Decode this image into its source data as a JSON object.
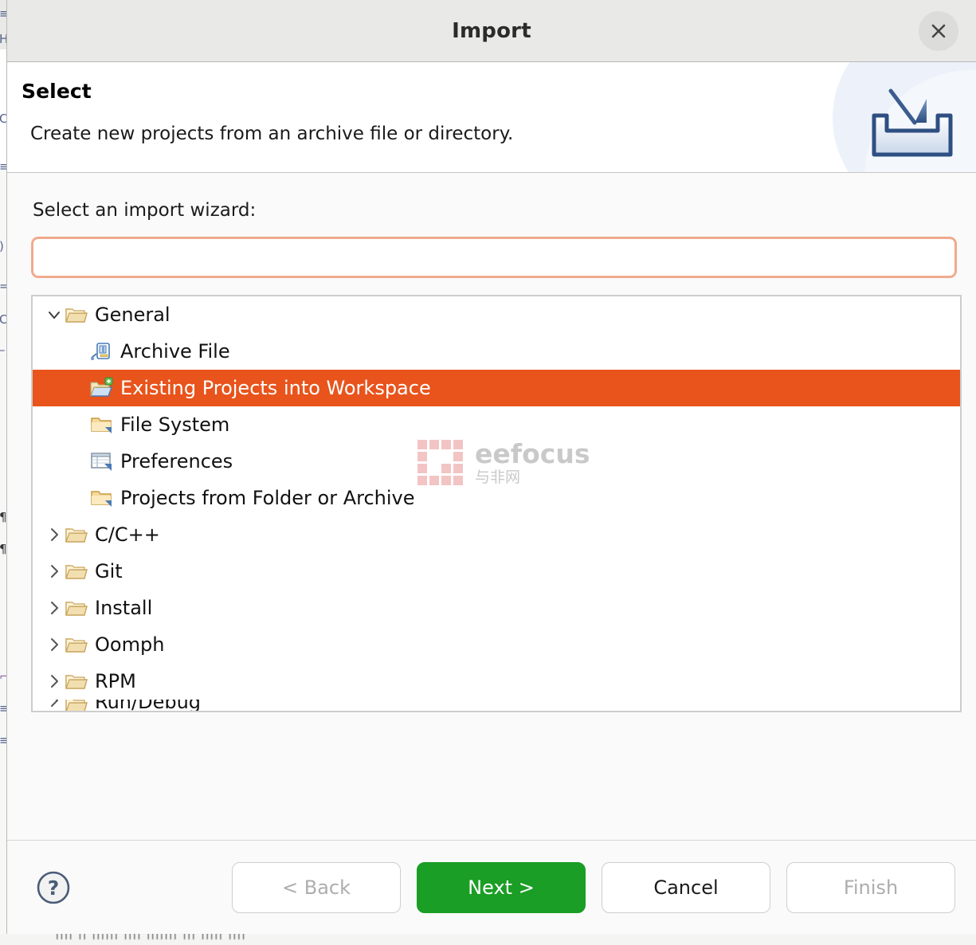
{
  "window": {
    "title": "Import",
    "close_label": "×"
  },
  "banner": {
    "title": "Select",
    "description": "Create new projects from an archive file or directory.",
    "icon": "import-tray-icon"
  },
  "form": {
    "filter_label": "Select an import wizard:",
    "filter_value": "",
    "filter_placeholder": ""
  },
  "tree": {
    "items": [
      {
        "label": "General",
        "level": 0,
        "twisty": "expanded",
        "icon": "open-folder-icon",
        "selected": false,
        "clipped": false
      },
      {
        "label": "Archive File",
        "level": 1,
        "twisty": "none",
        "icon": "archive-file-icon",
        "selected": false,
        "clipped": false
      },
      {
        "label": "Existing Projects into Workspace",
        "level": 1,
        "twisty": "none",
        "icon": "folder-plus-icon",
        "selected": true,
        "clipped": false
      },
      {
        "label": "File System",
        "level": 1,
        "twisty": "none",
        "icon": "folder-arrow-icon",
        "selected": false,
        "clipped": false
      },
      {
        "label": "Preferences",
        "level": 1,
        "twisty": "none",
        "icon": "preferences-table-icon",
        "selected": false,
        "clipped": false
      },
      {
        "label": "Projects from Folder or Archive",
        "level": 1,
        "twisty": "none",
        "icon": "folder-arrow-icon",
        "selected": false,
        "clipped": false
      },
      {
        "label": "C/C++",
        "level": 0,
        "twisty": "collapsed",
        "icon": "open-folder-icon",
        "selected": false,
        "clipped": false
      },
      {
        "label": "Git",
        "level": 0,
        "twisty": "collapsed",
        "icon": "open-folder-icon",
        "selected": false,
        "clipped": false
      },
      {
        "label": "Install",
        "level": 0,
        "twisty": "collapsed",
        "icon": "open-folder-icon",
        "selected": false,
        "clipped": false
      },
      {
        "label": "Oomph",
        "level": 0,
        "twisty": "collapsed",
        "icon": "open-folder-icon",
        "selected": false,
        "clipped": false
      },
      {
        "label": "RPM",
        "level": 0,
        "twisty": "collapsed",
        "icon": "open-folder-icon",
        "selected": false,
        "clipped": false
      },
      {
        "label": "Run/Debug",
        "level": 0,
        "twisty": "collapsed",
        "icon": "open-folder-icon",
        "selected": false,
        "clipped": true
      }
    ]
  },
  "watermark": {
    "main": "eefocus",
    "sub": "与非网"
  },
  "footer": {
    "help": "help-icon",
    "buttons": [
      {
        "label": "< Back",
        "state": "disabled",
        "name": "back-button"
      },
      {
        "label": "Next >",
        "state": "primary",
        "name": "next-button"
      },
      {
        "label": "Cancel",
        "state": "normal",
        "name": "cancel-button"
      },
      {
        "label": "Finish",
        "state": "disabled",
        "name": "finish-button"
      }
    ]
  },
  "colors": {
    "selection": "#e8541c",
    "primary_button": "#1a9e25",
    "focus_border": "#f0ab8d",
    "titlebar": "#e9e9e7"
  }
}
